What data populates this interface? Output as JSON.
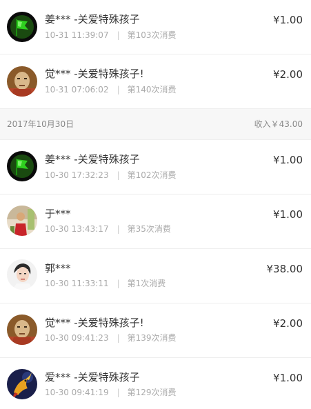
{
  "transactions_top": [
    {
      "avatar_icon": "green-flag-avatar-icon",
      "name": "姜*** -关爱特殊孩子",
      "time": "10-31 11:39:07",
      "sep": "|",
      "count_text": "第103次消费",
      "amount": "¥1.00"
    },
    {
      "avatar_icon": "monk-avatar-icon",
      "name": "觉*** -关爱特殊孩子!",
      "time": "10-31 07:06:02",
      "sep": "|",
      "count_text": "第140次消费",
      "amount": "¥2.00"
    }
  ],
  "date_header": {
    "date": "2017年10月30日",
    "income": "收入￥43.00"
  },
  "transactions_bottom": [
    {
      "avatar_icon": "green-flag-avatar-icon",
      "name": "姜*** -关爱特殊孩子",
      "time": "10-30 17:32:23",
      "sep": "|",
      "count_text": "第102次消费",
      "amount": "¥1.00"
    },
    {
      "avatar_icon": "person-red-shirt-avatar-icon",
      "name": "于***",
      "time": "10-30 13:43:17",
      "sep": "|",
      "count_text": "第35次消费",
      "amount": "¥1.00"
    },
    {
      "avatar_icon": "woman-portrait-avatar-icon",
      "name": "郭***",
      "time": "10-30 11:33:11",
      "sep": "|",
      "count_text": "第1次消费",
      "amount": "¥38.00"
    },
    {
      "avatar_icon": "monk-avatar-icon",
      "name": "觉*** -关爱特殊孩子!",
      "time": "10-30 09:41:23",
      "sep": "|",
      "count_text": "第139次消费",
      "amount": "¥2.00"
    },
    {
      "avatar_icon": "koi-fish-avatar-icon",
      "name": "爱*** -关爱特殊孩子",
      "time": "10-30 09:41:19",
      "sep": "|",
      "count_text": "第129次消费",
      "amount": "¥1.00"
    }
  ]
}
